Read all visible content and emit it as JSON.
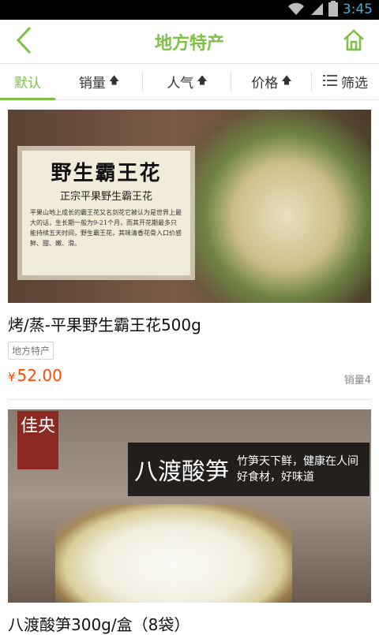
{
  "status_bar": {
    "time": "3:45"
  },
  "header": {
    "title": "地方特产"
  },
  "tabs": [
    {
      "label": "默认",
      "arrow": ""
    },
    {
      "label": "销量",
      "arrow": "🡅"
    },
    {
      "label": "人气",
      "arrow": "🡅"
    },
    {
      "label": "价格",
      "arrow": "🡅"
    },
    {
      "label": "筛选",
      "arrow": ""
    }
  ],
  "products": [
    {
      "name": "烤/蒸-平果野生霸王花500g",
      "tag": "地方特产",
      "currency": "¥",
      "price": "52.00",
      "sales": "销量4",
      "image": {
        "title": "野生霸王花",
        "subtitle": "正宗平果野生霸王花",
        "body": "平果山地上成长的霸王花又名剑花它被认为是世界上最大的话，生长期一般为9-21个月，而其开花期最多只能持续五天时间，野生霸王花，其味清香花骨入口价感鲜、甜、嫩、滑。"
      }
    },
    {
      "name": "八渡酸笋300g/盒（8袋）",
      "image": {
        "brand": "佳央",
        "title": "八渡酸笋",
        "slogan_line1": "竹笋天下鲜，健康在人间",
        "slogan_line2": "好食材，好味道"
      }
    }
  ],
  "colors": {
    "accent": "#7cc242",
    "price": "#ff4a00"
  }
}
